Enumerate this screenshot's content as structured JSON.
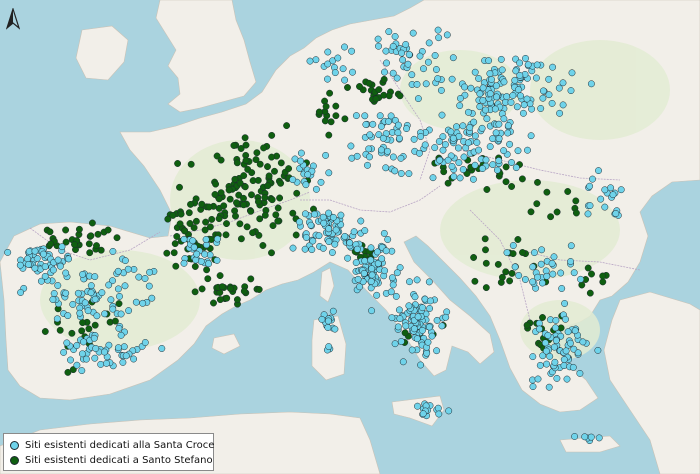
{
  "map": {
    "colors": {
      "sea": "#aad3df",
      "land": "#f2efe9",
      "rural": "#e3ecd3",
      "croce": "#6fd3ea",
      "stefano": "#0f5f10"
    }
  },
  "legend": {
    "items": [
      {
        "label": "Siti esistenti dedicati alla Santa Croce",
        "color": "#6fd3ea"
      },
      {
        "label": "Siti esistenti dedicati a Santo Stefano",
        "color": "#0f5f10"
      }
    ]
  },
  "north_arrow": {
    "icon": "north-arrow-icon"
  }
}
